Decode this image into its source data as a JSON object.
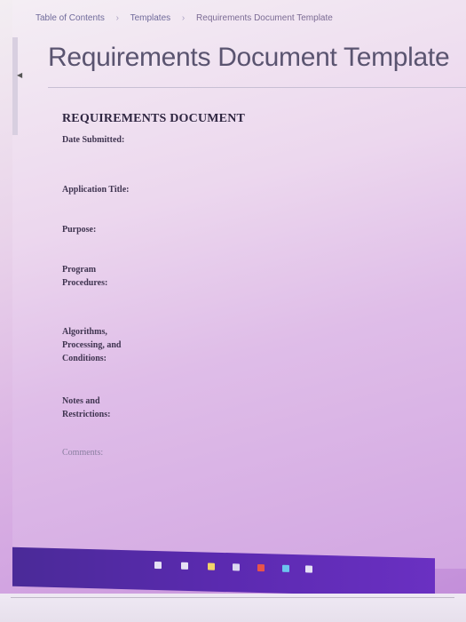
{
  "breadcrumb": {
    "items": [
      "Table of Contents",
      "Templates",
      "Requirements Document Template"
    ]
  },
  "page": {
    "title": "Requirements Document Template"
  },
  "document": {
    "heading": "REQUIREMENTS DOCUMENT",
    "fields": [
      {
        "label": "Date Submitted:"
      },
      {
        "label": "Application Title:"
      },
      {
        "label": "Purpose:"
      },
      {
        "label": "Program Procedures:"
      },
      {
        "label": "Algorithms, Processing, and Conditions:"
      },
      {
        "label": "Notes and Restrictions:"
      },
      {
        "label": "Comments:"
      }
    ]
  },
  "taskbar": {
    "icons": [
      "search-icon",
      "task-view-icon",
      "file-explorer-icon",
      "store-icon",
      "edge-icon",
      "chrome-icon",
      "settings-icon"
    ]
  },
  "colors": {
    "taskbar": "#5b2ab0",
    "title": "#5a5470"
  }
}
